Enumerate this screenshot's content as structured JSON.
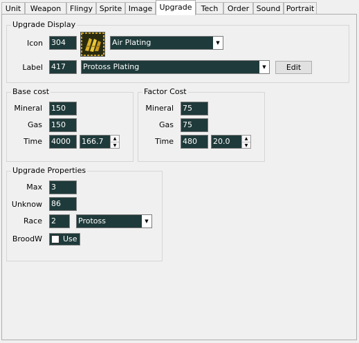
{
  "tabs": [
    "Unit",
    "Weapon",
    "Flingy",
    "Sprite",
    "Image",
    "Upgrade",
    "Tech",
    "Order",
    "Sound",
    "Portrait"
  ],
  "active_tab": "Upgrade",
  "upgrade_display": {
    "title": "Upgrade Display",
    "icon_label": "Icon",
    "icon_value": "304",
    "icon_name": "Air Plating",
    "icon_graphic": "air-plating-icon",
    "label_label": "Label",
    "label_value": "417",
    "label_name": "Protoss Plating",
    "edit_button": "Edit"
  },
  "base_cost": {
    "title": "Base cost",
    "mineral_label": "Mineral",
    "mineral": "150",
    "gas_label": "Gas",
    "gas": "150",
    "time_label": "Time",
    "time": "4000",
    "time_seconds": "166.7"
  },
  "factor_cost": {
    "title": "Factor Cost",
    "mineral_label": "Mineral",
    "mineral": "75",
    "gas_label": "Gas",
    "gas": "75",
    "time_label": "Time",
    "time": "480",
    "time_seconds": "20.0"
  },
  "upgrade_properties": {
    "title": "Upgrade Properties",
    "max_label": "Max",
    "max": "3",
    "unknow_label": "Unknow",
    "unknow": "86",
    "race_label": "Race",
    "race_value": "2",
    "race_name": "Protoss",
    "broodw_label": "BroodW",
    "use_label": "Use"
  },
  "colors": {
    "field_bg": "#1f3a3a",
    "field_text": "#ffffff"
  }
}
